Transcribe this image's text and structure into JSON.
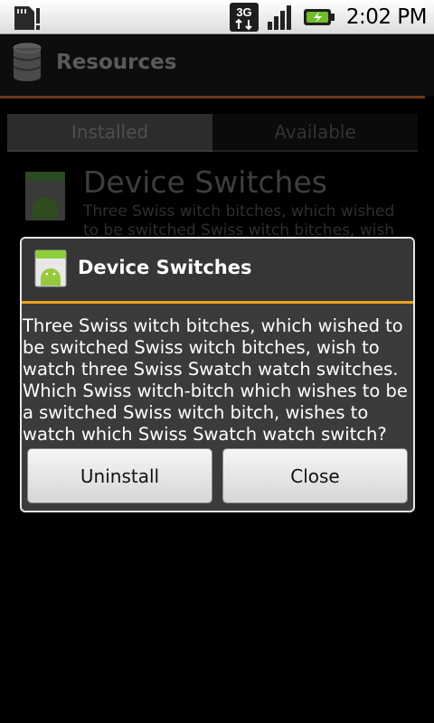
{
  "status_bar": {
    "time": "2:02 PM",
    "network_type": "3G",
    "icons": [
      "sd-card-icon",
      "network-3g-icon",
      "signal-icon",
      "battery-charging-icon"
    ]
  },
  "titlebar": {
    "title": "Resources",
    "icon": "database-icon"
  },
  "tabs": [
    {
      "label": "Installed",
      "selected": true
    },
    {
      "label": "Available",
      "selected": false
    }
  ],
  "list": {
    "items": [
      {
        "title": "Device Switches",
        "description": "Three Swiss witch bitches, which wished to be switched Swiss witch bitches, wish to",
        "icon": "android-app-icon"
      }
    ]
  },
  "dialog": {
    "title": "Device Switches",
    "icon": "android-app-icon",
    "message": "Three Swiss witch bitches, which wished to be switched Swiss witch bitches, wish to watch three Swiss Swatch watch switches. Which Swiss witch-bitch which wishes to be a switched Swiss witch bitch, wishes to watch which Swiss Swatch watch switch?",
    "buttons": {
      "primary": "Uninstall",
      "secondary": "Close"
    }
  },
  "colors": {
    "accent": "#f0a020",
    "title_rule": "#6a3a18",
    "dialog_bg": "#3b3b3b"
  }
}
